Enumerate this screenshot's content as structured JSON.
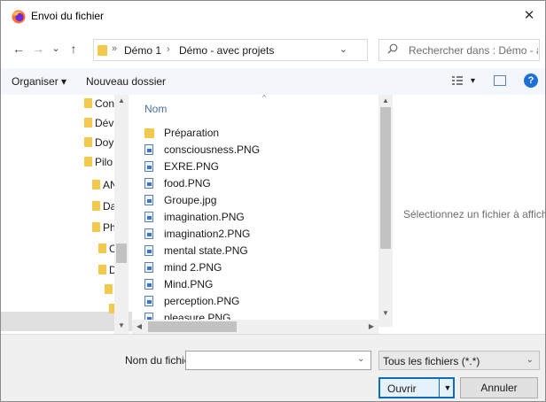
{
  "window": {
    "title": "Envoi du fichier",
    "close_glyph": "✕",
    "icon": "firefox-icon"
  },
  "nav": {
    "back_glyph": "←",
    "forward_glyph": "→",
    "recent_glyph": "⌄",
    "up_glyph": "↑",
    "refresh_glyph": "↻",
    "breadcrumb_sep": "»",
    "breadcrumb": [
      "Démo 1",
      "Démo - avec projets"
    ],
    "crumb_arrow": "›",
    "address_dropdown": "⌄"
  },
  "search": {
    "placeholder": "Rechercher dans : Démo - av..."
  },
  "toolbar": {
    "organize_label": "Organiser ▾",
    "new_folder_label": "Nouveau dossier",
    "view_dropdown": "▾",
    "help_glyph": "?"
  },
  "tree": {
    "items": [
      {
        "label": "Con",
        "indent": 1
      },
      {
        "label": "Dév",
        "indent": 1
      },
      {
        "label": "Doy",
        "indent": 1
      },
      {
        "label": "Pilo",
        "indent": 1
      },
      {
        "label": "AN",
        "indent": 2
      },
      {
        "label": "Da",
        "indent": 2
      },
      {
        "label": "Ph",
        "indent": 2
      },
      {
        "label": "C",
        "indent": 3
      },
      {
        "label": "D",
        "indent": 3
      },
      {
        "label": "",
        "indent": 4
      },
      {
        "label": "",
        "indent": 5
      }
    ]
  },
  "filelist": {
    "column_name": "Nom",
    "items": [
      {
        "name": "Préparation",
        "kind": "folder"
      },
      {
        "name": "consciousness.PNG",
        "kind": "file"
      },
      {
        "name": "EXRE.PNG",
        "kind": "file"
      },
      {
        "name": "food.PNG",
        "kind": "file"
      },
      {
        "name": "Groupe.jpg",
        "kind": "file"
      },
      {
        "name": "imagination.PNG",
        "kind": "file"
      },
      {
        "name": "imagination2.PNG",
        "kind": "file"
      },
      {
        "name": "mental state.PNG",
        "kind": "file"
      },
      {
        "name": "mind 2.PNG",
        "kind": "file"
      },
      {
        "name": "Mind.PNG",
        "kind": "file"
      },
      {
        "name": "perception.PNG",
        "kind": "file"
      },
      {
        "name": "pleasure.PNG",
        "kind": "file"
      }
    ]
  },
  "preview": {
    "message": "Sélectionnez un fichier à afficher."
  },
  "footer": {
    "filename_label": "Nom du fichier :",
    "filename_value": "",
    "filter_value": "Tous les fichiers (*.*)",
    "open_label": "Ouvrir",
    "cancel_label": "Annuler"
  }
}
